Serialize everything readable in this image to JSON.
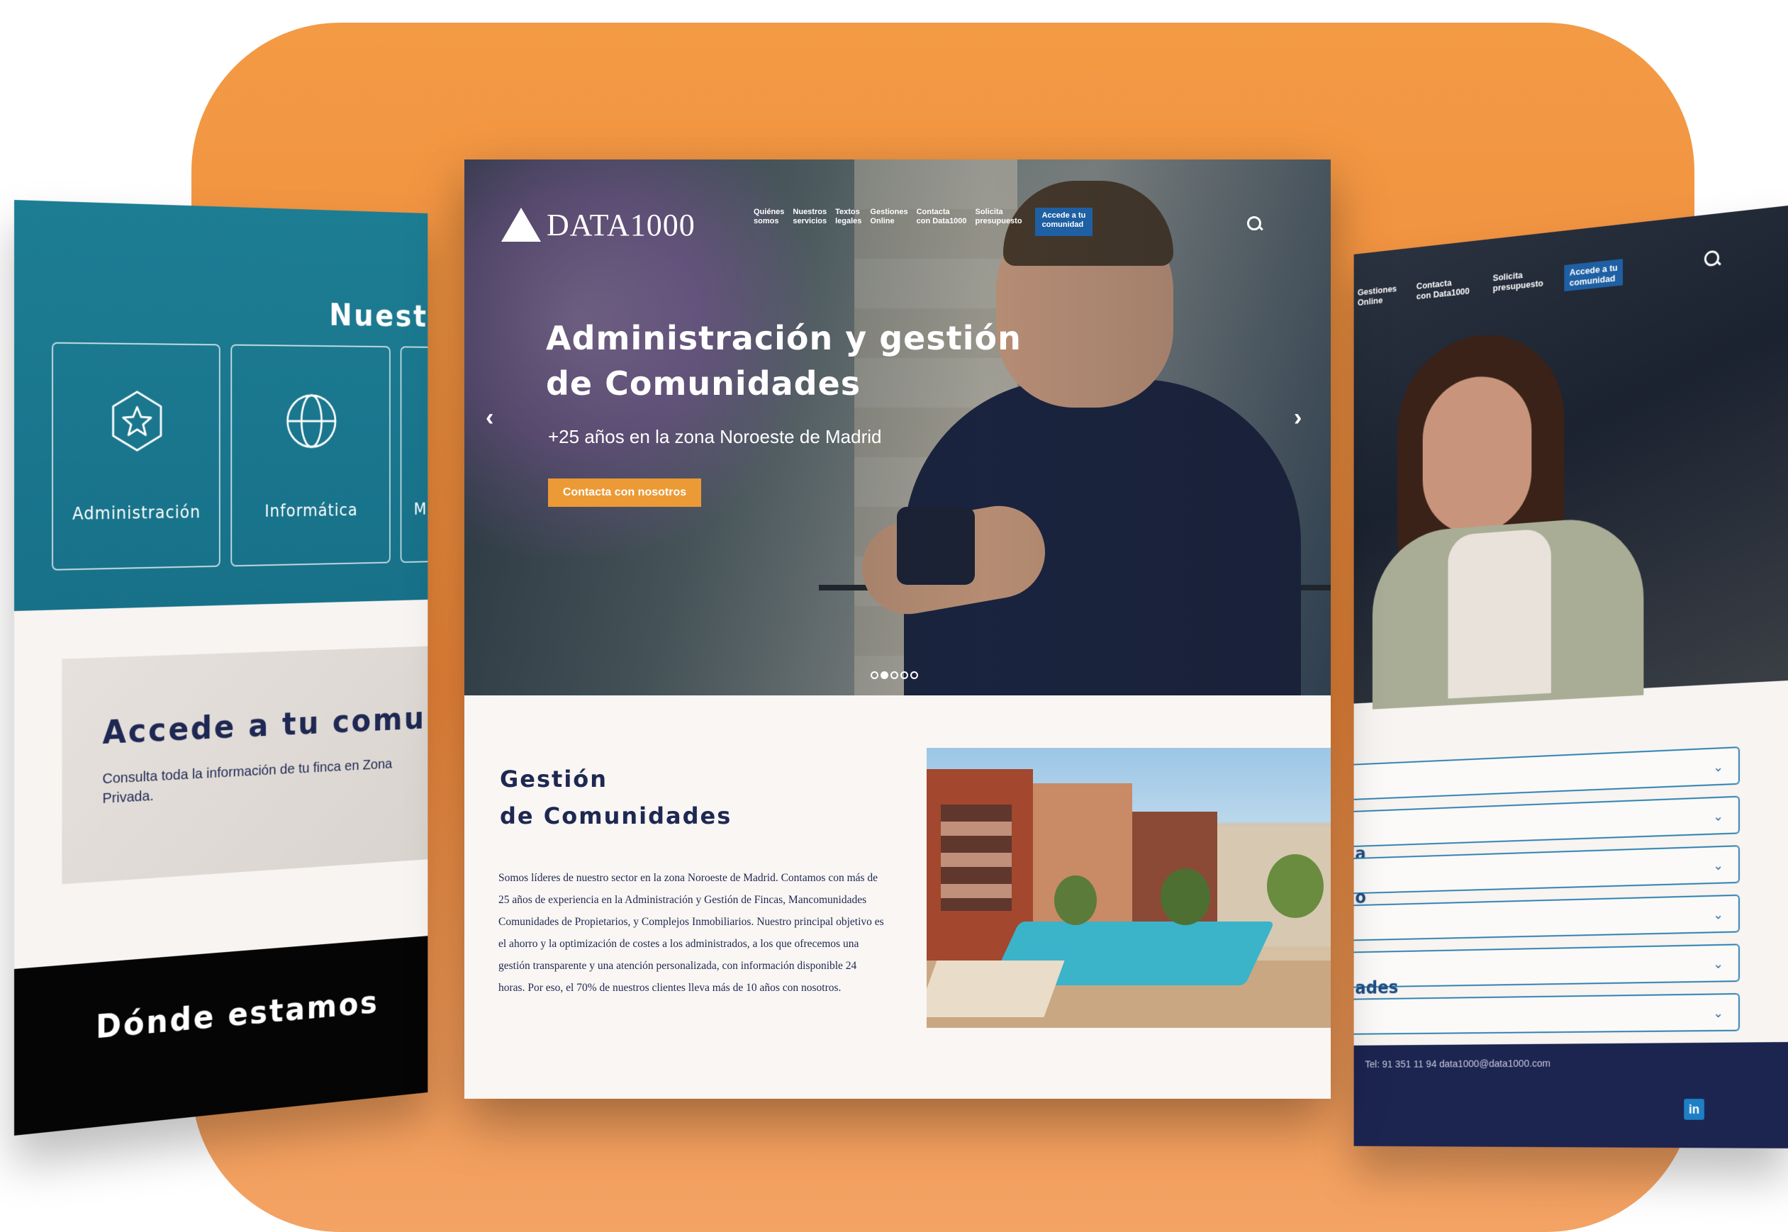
{
  "left_panel": {
    "section_title": "Nuestr",
    "services": [
      {
        "label": "Administración",
        "icon": "star-badge-icon"
      },
      {
        "label": "Informática",
        "icon": "globe-icon"
      },
      {
        "label": "Ma co",
        "icon": ""
      }
    ],
    "accede_title": "Accede a tu comu",
    "accede_text": "Consulta toda la información de tu finca en Zona Privada.",
    "donde_title": "Dónde estamos"
  },
  "center_panel": {
    "logo_text": "DATA1000",
    "nav": [
      "Quiénes\nsomos",
      "Nuestros\nservicios",
      "Textos\nlegales",
      "Gestiones\nOnline",
      "Contacta\ncon Data1000",
      "Solicita\npresupuesto"
    ],
    "nav_accede": "Accede a tu\ncomunidad",
    "hero_title": "Administración y gestión de Comunidades",
    "hero_subtitle": "+25 años en la zona Noroeste de Madrid",
    "cta_label": "Contacta con nosotros",
    "slider_dots": 5,
    "slider_active": 1,
    "section_title": "Gestión\nde Comunidades",
    "section_body": "Somos líderes de nuestro sector en la zona Noroeste de Madrid. Contamos con más de 25 años de experiencia en la Administración y Gestión de Fincas, Mancomunidades Comunidades de Propietarios, y Complejos Inmobiliarios. Nuestro principal objetivo es el ahorro y la optimización de costes a los administrados, a los que ofrecemos una gestión transparente y una atención personalizada, con información disponible 24 horas. Por eso, el 70% de nuestros clientes lleva más de 10 años con nosotros."
  },
  "right_panel": {
    "nav": [
      "Gestiones\nOnline",
      "Contacta\ncon Data1000",
      "Solicita\npresupuesto"
    ],
    "nav_accede": "Accede a tu\ncomunidad",
    "field_labels": [
      "a",
      "o",
      "ades"
    ],
    "footer_text": "Tel: 91 351 11 94  data1000@data1000.com",
    "linkedin": "in"
  },
  "colors": {
    "orange": "#f0883a",
    "teal": "#1a7890",
    "navy": "#1e2853",
    "accent_blue": "#1f5fa3",
    "cta_orange": "#ec9a35"
  }
}
